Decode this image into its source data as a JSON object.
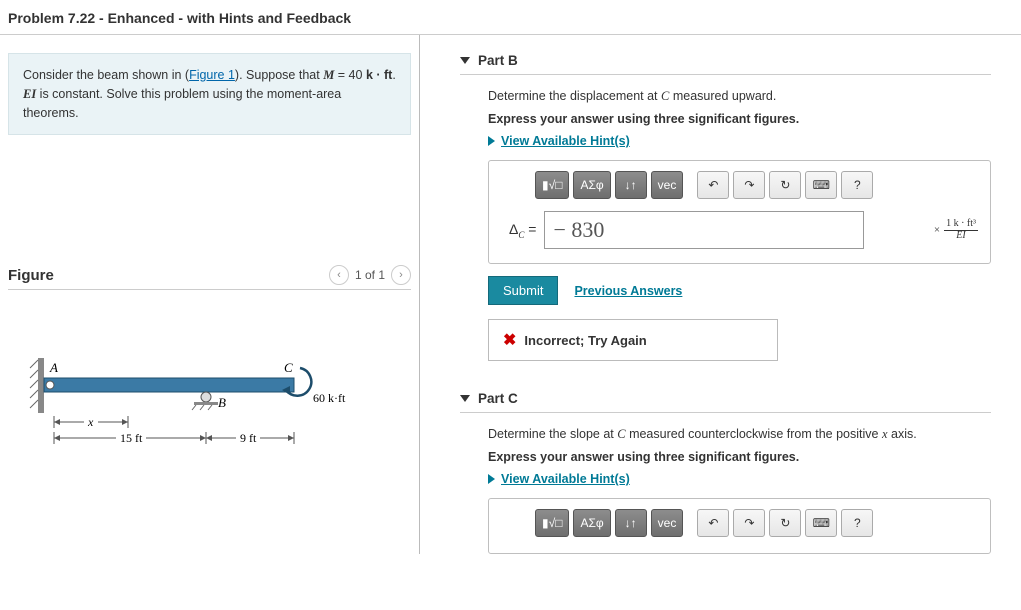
{
  "header": {
    "title": "Problem 7.22 - Enhanced - with Hints and Feedback"
  },
  "prompt": {
    "pre": "Consider the beam shown in (",
    "figlink": "Figure 1",
    "post1": "). Suppose that ",
    "mvar": "M",
    "meq": " = 40 ",
    "kft": "k · ft",
    "post2": ". ",
    "ei": "EI",
    "post3": " is constant. Solve this problem using the moment-area theorems."
  },
  "figure": {
    "heading": "Figure",
    "count": "1 of 1",
    "labels": {
      "A": "A",
      "B": "B",
      "C": "C",
      "x": "x",
      "d1": "15 ft",
      "d2": "9 ft",
      "moment": "60 k·ft"
    }
  },
  "partB": {
    "title": "Part B",
    "desc_pre": "Determine the displacement at ",
    "desc_var": "C",
    "desc_post": " measured upward.",
    "inst": "Express your answer using three significant figures.",
    "hints": "View Available Hint(s)",
    "delta_pre": "Δ",
    "delta_sub": "C",
    "eq": " = ",
    "value": "− 830",
    "unit_times": "×",
    "unit_top": "1 k · ft³",
    "unit_bot": "EI",
    "submit": "Submit",
    "prev": "Previous Answers",
    "feedback": "Incorrect; Try Again"
  },
  "partC": {
    "title": "Part C",
    "desc_pre": "Determine the slope at ",
    "desc_var": "C",
    "desc_mid": " measured counterclockwise from the positive ",
    "desc_var2": "x",
    "desc_post": " axis.",
    "inst": "Express your answer using three significant figures.",
    "hints": "View Available Hint(s)"
  },
  "toolbar": {
    "sqrt": "√□",
    "greek": "ΑΣφ",
    "updown": "↓↑",
    "vec": "vec",
    "undo": "↶",
    "redo": "↷",
    "reset": "↻",
    "kbd": "⌨",
    "help": "?"
  }
}
